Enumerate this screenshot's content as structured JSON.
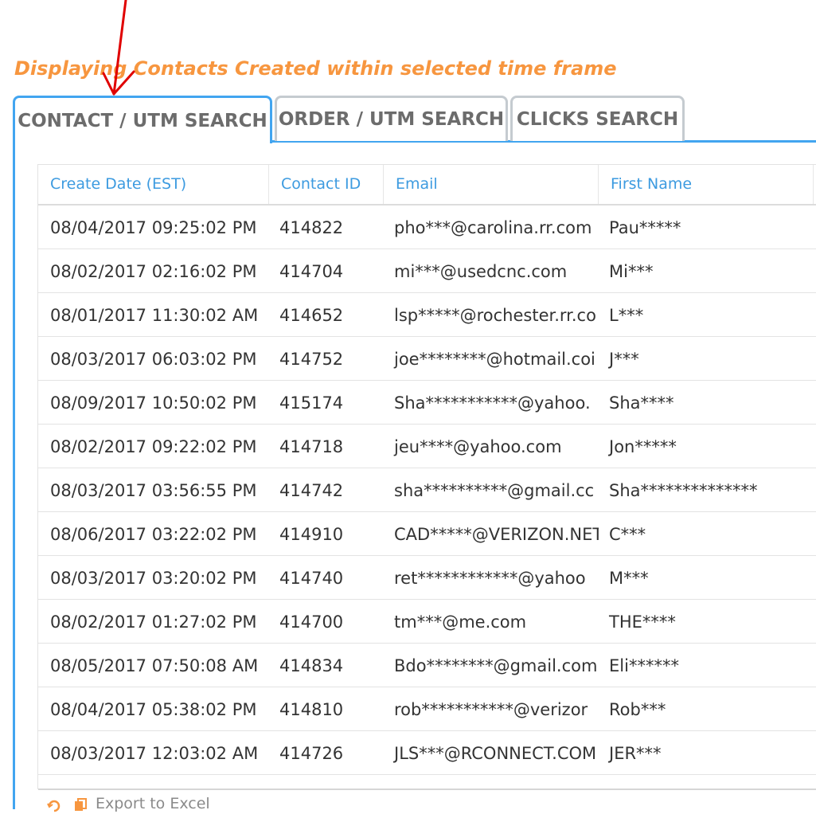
{
  "heading": "Displaying Contacts Created within selected time frame",
  "tabs": [
    {
      "label": "CONTACT / UTM SEARCH",
      "active": true
    },
    {
      "label": "ORDER / UTM SEARCH",
      "active": false
    },
    {
      "label": "CLICKS SEARCH",
      "active": false
    }
  ],
  "table": {
    "columns": [
      "Create Date (EST)",
      "Contact ID",
      "Email",
      "First Name"
    ],
    "rows": [
      [
        "08/04/2017 09:25:02 PM",
        "414822",
        "pho***@carolina.rr.com",
        "Pau*****"
      ],
      [
        "08/02/2017 02:16:02 PM",
        "414704",
        "mi***@usedcnc.com",
        "Mi***"
      ],
      [
        "08/01/2017 11:30:02 AM",
        "414652",
        "lsp*****@rochester.rr.co",
        "L***"
      ],
      [
        "08/03/2017 06:03:02 PM",
        "414752",
        "joe********@hotmail.coi",
        "J***"
      ],
      [
        "08/09/2017 10:50:02 PM",
        "415174",
        "Sha***********@yahoo.",
        "Sha****"
      ],
      [
        "08/02/2017 09:22:02 PM",
        "414718",
        "jeu****@yahoo.com",
        "Jon*****"
      ],
      [
        "08/03/2017 03:56:55 PM",
        "414742",
        "sha**********@gmail.cc",
        "Sha**************"
      ],
      [
        "08/06/2017 03:22:02 PM",
        "414910",
        "CAD*****@VERIZON.NET",
        "C***"
      ],
      [
        "08/03/2017 03:20:02 PM",
        "414740",
        "ret************@yahoo",
        "M***"
      ],
      [
        "08/02/2017 01:27:02 PM",
        "414700",
        "tm***@me.com",
        "THE****"
      ],
      [
        "08/05/2017 07:50:08 AM",
        "414834",
        "Bdo********@gmail.com",
        "Eli******"
      ],
      [
        "08/04/2017 05:38:02 PM",
        "414810",
        "rob***********@verizor",
        "Rob***"
      ],
      [
        "08/03/2017 12:03:02 AM",
        "414726",
        "JLS***@RCONNECT.COM",
        "JER***"
      ]
    ]
  },
  "footer": {
    "export_label": "Export to Excel"
  },
  "icons": {
    "refresh": "refresh-icon",
    "excel": "excel-icon",
    "annotation": "red-arrow-annotation"
  },
  "colors": {
    "accent": "#42a5f0",
    "heading": "#f7963f",
    "tab_border": "#c5cbd0",
    "arrow": "#e00000"
  }
}
